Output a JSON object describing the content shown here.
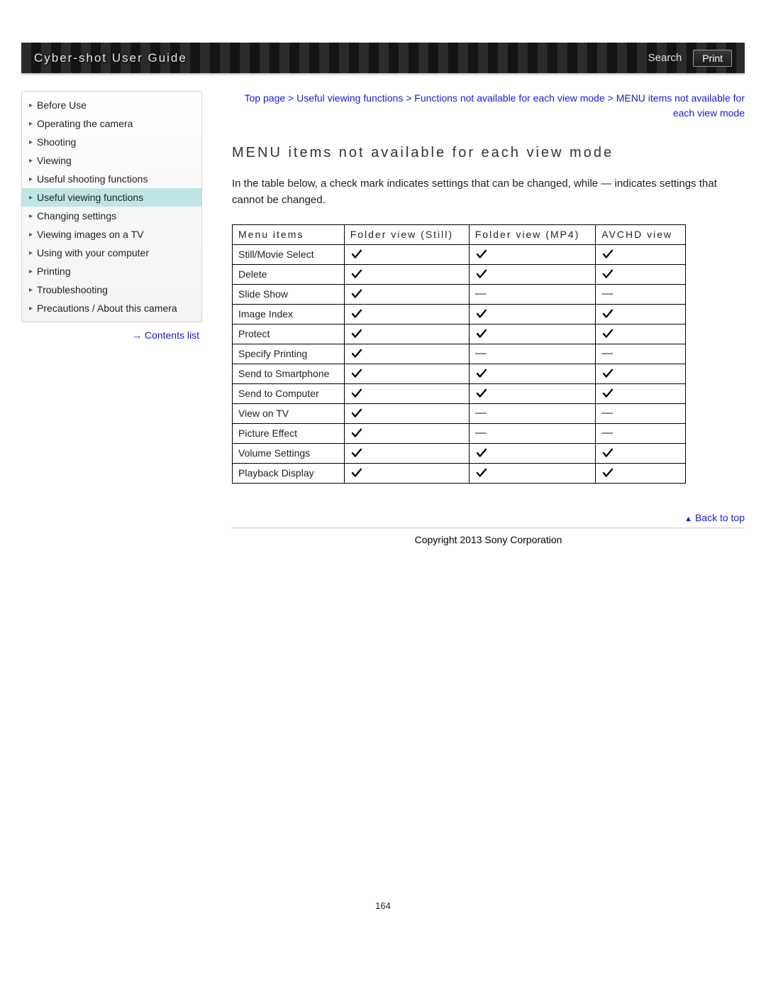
{
  "header": {
    "title": "Cyber-shot User Guide",
    "search_label": "Search",
    "print_label": "Print"
  },
  "sidebar": {
    "items": [
      {
        "label": "Before Use",
        "active": false
      },
      {
        "label": "Operating the camera",
        "active": false
      },
      {
        "label": "Shooting",
        "active": false
      },
      {
        "label": "Viewing",
        "active": false
      },
      {
        "label": "Useful shooting functions",
        "active": false
      },
      {
        "label": "Useful viewing functions",
        "active": true
      },
      {
        "label": "Changing settings",
        "active": false
      },
      {
        "label": "Viewing images on a TV",
        "active": false
      },
      {
        "label": "Using with your computer",
        "active": false
      },
      {
        "label": "Printing",
        "active": false
      },
      {
        "label": "Troubleshooting",
        "active": false
      },
      {
        "label": "Precautions / About this camera",
        "active": false
      }
    ],
    "contents_link": "Contents list"
  },
  "breadcrumb": "Top page > Useful viewing functions > Functions not available for each view mode > MENU items not available for each view mode",
  "main": {
    "heading": "MENU items not available for each view mode",
    "intro": "In the table below, a check mark indicates settings that can be changed, while — indicates settings that cannot be changed.",
    "table": {
      "headers": [
        "Menu items",
        "Folder view (Still)",
        "Folder view (MP4)",
        "AVCHD view"
      ],
      "rows": [
        {
          "name": "Still/Movie Select",
          "vals": [
            "check",
            "check",
            "check"
          ]
        },
        {
          "name": "Delete",
          "vals": [
            "check",
            "check",
            "check"
          ]
        },
        {
          "name": "Slide Show",
          "vals": [
            "check",
            "dash",
            "dash"
          ]
        },
        {
          "name": "Image Index",
          "vals": [
            "check",
            "check",
            "check"
          ]
        },
        {
          "name": "Protect",
          "vals": [
            "check",
            "check",
            "check"
          ]
        },
        {
          "name": "Specify Printing",
          "vals": [
            "check",
            "dash",
            "dash"
          ]
        },
        {
          "name": "Send to Smartphone",
          "vals": [
            "check",
            "check",
            "check"
          ]
        },
        {
          "name": "Send to Computer",
          "vals": [
            "check",
            "check",
            "check"
          ]
        },
        {
          "name": "View on TV",
          "vals": [
            "check",
            "dash",
            "dash"
          ]
        },
        {
          "name": "Picture Effect",
          "vals": [
            "check",
            "dash",
            "dash"
          ]
        },
        {
          "name": "Volume Settings",
          "vals": [
            "check",
            "check",
            "check"
          ]
        },
        {
          "name": "Playback Display",
          "vals": [
            "check",
            "check",
            "check"
          ]
        }
      ]
    }
  },
  "footer": {
    "back_to_top": "Back to top",
    "copyright": "Copyright 2013 Sony Corporation",
    "page_num": "164"
  }
}
